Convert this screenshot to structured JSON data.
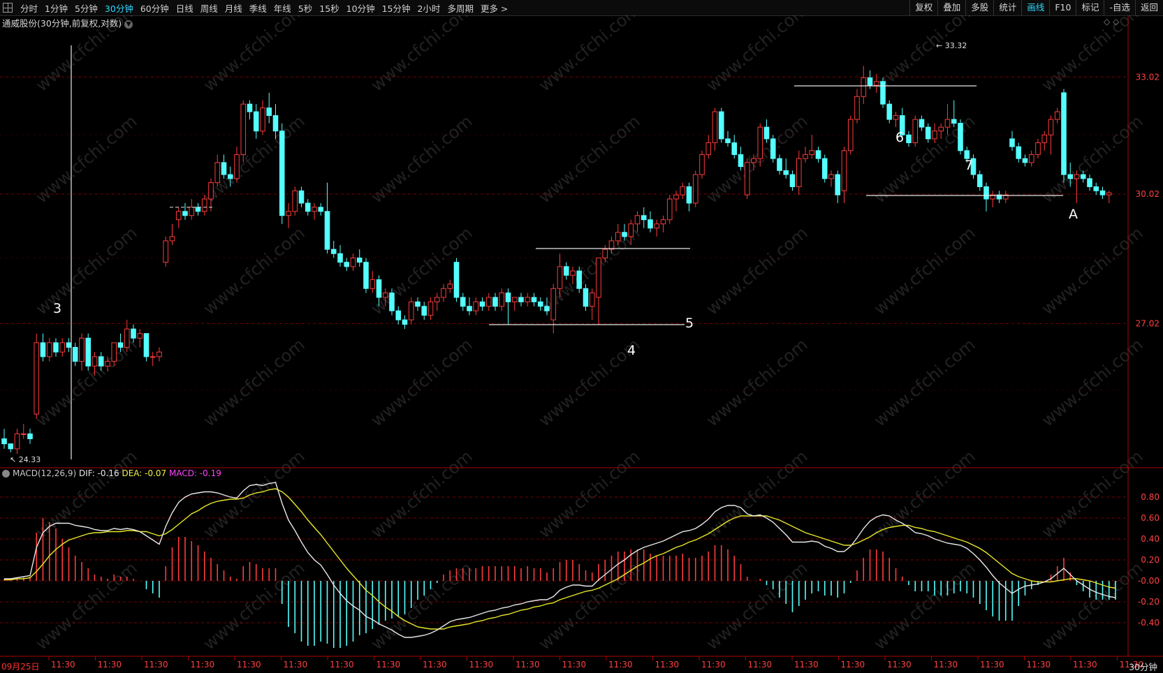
{
  "toolbar": {
    "periods": [
      {
        "label": "分时"
      },
      {
        "label": "1分钟"
      },
      {
        "label": "5分钟"
      },
      {
        "label": "30分钟",
        "active": true
      },
      {
        "label": "60分钟"
      },
      {
        "label": "日线"
      },
      {
        "label": "周线"
      },
      {
        "label": "月线"
      },
      {
        "label": "季线"
      },
      {
        "label": "年线"
      },
      {
        "label": "5秒"
      },
      {
        "label": "15秒"
      },
      {
        "label": "10分钟"
      },
      {
        "label": "15分钟"
      },
      {
        "label": "2小时"
      },
      {
        "label": "多周期"
      },
      {
        "label": "更多 >"
      }
    ],
    "right_buttons": [
      {
        "label": "复权"
      },
      {
        "label": "叠加"
      },
      {
        "label": "多股"
      },
      {
        "label": "统计"
      },
      {
        "label": "画线",
        "active": true
      },
      {
        "label": "F10"
      },
      {
        "label": "标记"
      },
      {
        "label": "-自选"
      },
      {
        "label": "返回"
      }
    ]
  },
  "chart_title": "通威股份(30分钟,前复权,对数)",
  "price_axis": [
    "33.02",
    "30.02",
    "27.02"
  ],
  "high_label": "33.32",
  "low_label": "24.33",
  "annotations": {
    "n3": "3",
    "n4": "4",
    "n5": "5",
    "n6": "6",
    "n7": "7",
    "nA": "A"
  },
  "macd": {
    "name": "MACD(12,26,9)",
    "dif_label": "DIF: -0.16",
    "dea_label": "DEA: -0.07",
    "macd_label": "MACD: -0.19",
    "axis": [
      "0.80",
      "0.60",
      "0.40",
      "0.20",
      "-0.00",
      "-0.20",
      "-0.40"
    ]
  },
  "time_axis": {
    "first_date": "09月25日",
    "tick_label": "11:30",
    "period": "30分钟"
  },
  "watermark": "www.cfchi.com",
  "colors": {
    "up": "#ff3b3b",
    "down": "#54ffff",
    "dif": "#e8e8e8",
    "dea": "#e8e82a",
    "grid": "#7a0000",
    "active": "#2fd9ff"
  },
  "chart_data": {
    "type": "candlestick",
    "scale": "log",
    "interval": "30分钟",
    "price_range": [
      24.33,
      33.32
    ],
    "candles": [
      [
        24.6,
        24.8,
        24.4,
        24.5
      ],
      [
        24.5,
        24.5,
        24.33,
        24.4
      ],
      [
        24.4,
        24.8,
        24.3,
        24.7
      ],
      [
        24.7,
        24.9,
        24.6,
        24.7
      ],
      [
        24.7,
        24.8,
        24.5,
        24.6
      ],
      [
        25.1,
        26.8,
        25.0,
        26.6
      ],
      [
        26.6,
        26.8,
        26.2,
        26.3
      ],
      [
        26.3,
        26.7,
        26.2,
        26.6
      ],
      [
        26.6,
        26.7,
        26.3,
        26.4
      ],
      [
        26.4,
        26.7,
        26.3,
        26.6
      ],
      [
        26.6,
        26.7,
        26.4,
        26.5
      ],
      [
        26.5,
        26.6,
        26.1,
        26.2
      ],
      [
        26.2,
        26.8,
        26.0,
        26.7
      ],
      [
        26.7,
        26.8,
        26.0,
        26.1
      ],
      [
        26.1,
        26.4,
        25.9,
        26.3
      ],
      [
        26.3,
        26.4,
        26.0,
        26.1
      ],
      [
        26.1,
        26.3,
        26.0,
        26.2
      ],
      [
        26.2,
        26.6,
        26.1,
        26.6
      ],
      [
        26.6,
        26.8,
        26.4,
        26.5
      ],
      [
        26.5,
        27.1,
        26.4,
        26.9
      ],
      [
        26.9,
        27.0,
        26.6,
        26.7
      ],
      [
        26.7,
        26.9,
        26.5,
        26.8
      ],
      [
        26.8,
        26.8,
        26.2,
        26.3
      ],
      [
        26.3,
        26.4,
        26.1,
        26.3
      ],
      [
        26.3,
        26.5,
        26.2,
        26.4
      ],
      [
        28.4,
        29.0,
        28.3,
        28.9
      ],
      [
        28.9,
        29.3,
        28.8,
        29.0
      ],
      [
        29.4,
        29.7,
        29.2,
        29.6
      ],
      [
        29.6,
        29.8,
        29.4,
        29.5
      ],
      [
        29.5,
        29.9,
        29.4,
        29.7
      ],
      [
        29.7,
        29.8,
        29.5,
        29.6
      ],
      [
        29.6,
        30.0,
        29.5,
        29.9
      ],
      [
        29.9,
        30.4,
        29.6,
        30.3
      ],
      [
        30.3,
        31.0,
        30.2,
        30.8
      ],
      [
        30.8,
        31.0,
        30.4,
        30.5
      ],
      [
        30.5,
        30.7,
        30.2,
        30.4
      ],
      [
        30.4,
        31.2,
        30.3,
        31.0
      ],
      [
        31.0,
        32.4,
        30.8,
        32.3
      ],
      [
        32.3,
        32.4,
        31.9,
        32.1
      ],
      [
        32.1,
        32.3,
        31.4,
        31.6
      ],
      [
        31.6,
        32.4,
        31.5,
        32.2
      ],
      [
        32.2,
        32.6,
        31.8,
        32.0
      ],
      [
        32.0,
        32.3,
        31.4,
        31.6
      ],
      [
        31.6,
        31.8,
        29.3,
        29.5
      ],
      [
        29.5,
        29.8,
        29.2,
        29.6
      ],
      [
        29.6,
        30.2,
        29.5,
        30.1
      ],
      [
        30.1,
        30.2,
        29.7,
        29.8
      ],
      [
        29.8,
        29.9,
        29.5,
        29.6
      ],
      [
        29.6,
        29.8,
        29.4,
        29.7
      ],
      [
        29.7,
        29.8,
        29.5,
        29.6
      ],
      [
        29.6,
        30.3,
        28.6,
        28.7
      ],
      [
        28.7,
        28.9,
        28.5,
        28.6
      ],
      [
        28.6,
        28.8,
        28.3,
        28.4
      ],
      [
        28.4,
        28.5,
        28.2,
        28.3
      ],
      [
        28.3,
        28.6,
        28.2,
        28.5
      ],
      [
        28.5,
        28.7,
        28.3,
        28.4
      ],
      [
        28.4,
        28.5,
        27.7,
        27.8
      ],
      [
        27.8,
        28.2,
        27.7,
        28.0
      ],
      [
        28.0,
        28.1,
        27.4,
        27.6
      ],
      [
        27.6,
        27.8,
        27.4,
        27.7
      ],
      [
        27.7,
        27.8,
        27.2,
        27.3
      ],
      [
        27.3,
        27.4,
        27.0,
        27.1
      ],
      [
        27.1,
        27.2,
        26.9,
        27.0
      ],
      [
        27.1,
        27.6,
        27.0,
        27.5
      ],
      [
        27.5,
        27.6,
        27.3,
        27.4
      ],
      [
        27.4,
        27.5,
        27.1,
        27.2
      ],
      [
        27.2,
        27.6,
        27.1,
        27.5
      ],
      [
        27.5,
        27.7,
        27.3,
        27.6
      ],
      [
        27.6,
        27.9,
        27.5,
        27.8
      ],
      [
        27.8,
        28.0,
        27.7,
        27.9
      ],
      [
        28.4,
        28.5,
        27.5,
        27.6
      ],
      [
        27.6,
        27.7,
        27.3,
        27.4
      ],
      [
        27.4,
        27.6,
        27.2,
        27.3
      ],
      [
        27.3,
        27.6,
        27.2,
        27.5
      ],
      [
        27.5,
        27.6,
        27.3,
        27.4
      ],
      [
        27.4,
        27.7,
        27.3,
        27.6
      ],
      [
        27.6,
        27.7,
        27.3,
        27.4
      ],
      [
        27.4,
        27.8,
        27.3,
        27.7
      ],
      [
        27.7,
        27.8,
        27.0,
        27.5
      ],
      [
        27.5,
        27.6,
        27.3,
        27.6
      ],
      [
        27.6,
        27.7,
        27.4,
        27.5
      ],
      [
        27.5,
        27.7,
        27.4,
        27.6
      ],
      [
        27.6,
        27.7,
        27.4,
        27.5
      ],
      [
        27.5,
        27.6,
        27.3,
        27.4
      ],
      [
        27.4,
        27.6,
        27.2,
        27.3
      ],
      [
        27.1,
        27.9,
        26.8,
        27.8
      ],
      [
        27.8,
        28.6,
        27.6,
        28.3
      ],
      [
        28.3,
        28.4,
        28.0,
        28.1
      ],
      [
        28.1,
        28.3,
        27.9,
        28.2
      ],
      [
        28.2,
        28.3,
        27.7,
        27.8
      ],
      [
        27.8,
        27.9,
        27.3,
        27.4
      ],
      [
        27.4,
        27.8,
        27.1,
        27.7
      ],
      [
        27.6,
        28.5,
        27.0,
        28.5
      ],
      [
        28.5,
        28.8,
        28.4,
        28.7
      ],
      [
        28.7,
        29.0,
        28.6,
        28.9
      ],
      [
        28.9,
        29.3,
        28.8,
        29.1
      ],
      [
        29.1,
        29.3,
        28.9,
        29.0
      ],
      [
        29.0,
        29.4,
        28.8,
        29.3
      ],
      [
        29.3,
        29.6,
        29.1,
        29.5
      ],
      [
        29.5,
        29.7,
        29.2,
        29.4
      ],
      [
        29.4,
        29.6,
        29.1,
        29.2
      ],
      [
        29.2,
        29.4,
        29.0,
        29.3
      ],
      [
        29.3,
        29.5,
        29.1,
        29.4
      ],
      [
        29.4,
        30.0,
        29.3,
        29.9
      ],
      [
        29.9,
        30.1,
        29.6,
        30.0
      ],
      [
        30.0,
        30.3,
        29.9,
        30.2
      ],
      [
        30.2,
        30.3,
        29.6,
        29.8
      ],
      [
        29.8,
        30.6,
        29.7,
        30.5
      ],
      [
        30.5,
        31.1,
        30.4,
        31.0
      ],
      [
        31.0,
        31.5,
        30.9,
        31.3
      ],
      [
        31.3,
        32.2,
        31.1,
        32.1
      ],
      [
        32.1,
        32.2,
        31.3,
        31.4
      ],
      [
        31.4,
        31.6,
        31.2,
        31.3
      ],
      [
        31.3,
        31.5,
        30.9,
        31.0
      ],
      [
        31.0,
        31.2,
        30.6,
        30.7
      ],
      [
        30.0,
        30.9,
        29.9,
        30.8
      ],
      [
        30.8,
        31.0,
        30.6,
        30.9
      ],
      [
        30.9,
        31.8,
        30.7,
        31.7
      ],
      [
        31.7,
        31.9,
        31.3,
        31.4
      ],
      [
        31.4,
        31.5,
        30.8,
        30.9
      ],
      [
        30.9,
        31.0,
        30.5,
        30.6
      ],
      [
        30.6,
        30.9,
        30.4,
        30.5
      ],
      [
        30.5,
        30.6,
        30.1,
        30.2
      ],
      [
        30.2,
        31.1,
        30.0,
        30.9
      ],
      [
        30.9,
        31.2,
        30.8,
        31.0
      ],
      [
        31.0,
        31.5,
        30.9,
        31.1
      ],
      [
        31.1,
        31.2,
        30.8,
        30.9
      ],
      [
        30.9,
        31.0,
        30.3,
        30.4
      ],
      [
        30.4,
        30.6,
        30.2,
        30.5
      ],
      [
        30.5,
        30.6,
        29.8,
        30.0
      ],
      [
        30.1,
        31.2,
        29.8,
        31.1
      ],
      [
        31.1,
        32.0,
        31.0,
        31.9
      ],
      [
        31.9,
        32.7,
        31.8,
        32.5
      ],
      [
        32.5,
        33.32,
        32.3,
        33.0
      ],
      [
        33.0,
        33.2,
        32.7,
        32.8
      ],
      [
        32.8,
        33.1,
        32.6,
        32.9
      ],
      [
        32.9,
        33.0,
        32.2,
        32.3
      ],
      [
        32.3,
        32.4,
        31.8,
        31.9
      ],
      [
        31.9,
        32.1,
        31.7,
        32.0
      ],
      [
        32.0,
        32.2,
        31.4,
        31.5
      ],
      [
        31.5,
        31.6,
        31.2,
        31.3
      ],
      [
        31.3,
        32.0,
        31.2,
        31.9
      ],
      [
        31.9,
        32.0,
        31.6,
        31.7
      ],
      [
        31.7,
        31.8,
        31.3,
        31.4
      ],
      [
        31.4,
        31.8,
        31.3,
        31.6
      ],
      [
        31.6,
        31.8,
        31.4,
        31.7
      ],
      [
        31.7,
        32.3,
        31.5,
        31.9
      ],
      [
        31.9,
        32.4,
        31.7,
        31.8
      ],
      [
        31.8,
        31.9,
        31.0,
        31.1
      ],
      [
        31.1,
        31.2,
        30.8,
        30.9
      ],
      [
        30.9,
        31.0,
        30.4,
        30.5
      ],
      [
        30.5,
        30.6,
        30.1,
        30.2
      ],
      [
        30.2,
        30.3,
        29.6,
        29.9
      ],
      [
        29.9,
        30.1,
        29.7,
        30.0
      ],
      [
        30.0,
        30.1,
        29.8,
        29.9
      ],
      [
        29.9,
        30.1,
        29.8,
        30.0
      ],
      [
        31.4,
        31.6,
        31.1,
        31.2
      ],
      [
        31.2,
        31.3,
        30.8,
        30.9
      ],
      [
        30.9,
        31.0,
        30.7,
        30.8
      ],
      [
        30.8,
        31.1,
        30.7,
        31.0
      ],
      [
        31.0,
        31.4,
        30.9,
        31.3
      ],
      [
        31.3,
        31.6,
        31.1,
        31.5
      ],
      [
        31.5,
        32.0,
        31.0,
        31.9
      ],
      [
        31.9,
        32.2,
        31.8,
        32.1
      ],
      [
        32.6,
        32.7,
        30.3,
        30.5
      ],
      [
        30.5,
        30.8,
        30.2,
        30.4
      ],
      [
        30.4,
        30.6,
        29.8,
        30.5
      ],
      [
        30.5,
        30.6,
        30.3,
        30.4
      ],
      [
        30.4,
        30.5,
        30.1,
        30.2
      ],
      [
        30.2,
        30.3,
        30.0,
        30.1
      ],
      [
        30.1,
        30.2,
        29.9,
        30.0
      ],
      [
        30.0,
        30.1,
        29.8,
        30.05
      ]
    ],
    "macd": {
      "dif_last": -0.16,
      "dea_last": -0.07,
      "macd_last": -0.19,
      "dif": [
        0.02,
        0.02,
        0.03,
        0.04,
        0.05,
        0.32,
        0.46,
        0.52,
        0.55,
        0.55,
        0.55,
        0.53,
        0.52,
        0.51,
        0.49,
        0.48,
        0.48,
        0.5,
        0.49,
        0.5,
        0.49,
        0.47,
        0.43,
        0.39,
        0.35,
        0.52,
        0.65,
        0.75,
        0.8,
        0.83,
        0.84,
        0.85,
        0.85,
        0.84,
        0.82,
        0.8,
        0.79,
        0.86,
        0.91,
        0.92,
        0.91,
        0.93,
        0.94,
        0.74,
        0.58,
        0.48,
        0.37,
        0.27,
        0.2,
        0.15,
        0.06,
        -0.04,
        -0.12,
        -0.19,
        -0.24,
        -0.28,
        -0.34,
        -0.37,
        -0.41,
        -0.44,
        -0.47,
        -0.51,
        -0.54,
        -0.54,
        -0.53,
        -0.52,
        -0.5,
        -0.47,
        -0.43,
        -0.39,
        -0.37,
        -0.36,
        -0.35,
        -0.33,
        -0.31,
        -0.29,
        -0.28,
        -0.26,
        -0.25,
        -0.23,
        -0.22,
        -0.2,
        -0.19,
        -0.18,
        -0.18,
        -0.15,
        -0.09,
        -0.06,
        -0.04,
        -0.04,
        -0.05,
        -0.05,
        0.01,
        0.06,
        0.11,
        0.16,
        0.2,
        0.25,
        0.29,
        0.32,
        0.34,
        0.36,
        0.38,
        0.41,
        0.44,
        0.47,
        0.48,
        0.5,
        0.54,
        0.59,
        0.66,
        0.7,
        0.72,
        0.72,
        0.7,
        0.64,
        0.62,
        0.63,
        0.6,
        0.56,
        0.5,
        0.44,
        0.37,
        0.37,
        0.37,
        0.38,
        0.37,
        0.33,
        0.31,
        0.28,
        0.28,
        0.33,
        0.41,
        0.5,
        0.57,
        0.61,
        0.63,
        0.62,
        0.58,
        0.55,
        0.51,
        0.46,
        0.45,
        0.43,
        0.4,
        0.38,
        0.36,
        0.35,
        0.34,
        0.31,
        0.26,
        0.2,
        0.13,
        0.05,
        -0.02,
        -0.07,
        -0.12,
        -0.08,
        -0.05,
        -0.04,
        -0.03,
        -0.01,
        0.02,
        0.07,
        0.12,
        0.06,
        0.0,
        -0.04,
        -0.08,
        -0.11,
        -0.13,
        -0.15,
        -0.16
      ],
      "dea": [
        0.01,
        0.01,
        0.02,
        0.02,
        0.03,
        0.09,
        0.16,
        0.24,
        0.3,
        0.35,
        0.39,
        0.41,
        0.43,
        0.45,
        0.46,
        0.46,
        0.47,
        0.47,
        0.47,
        0.48,
        0.48,
        0.47,
        0.47,
        0.45,
        0.43,
        0.45,
        0.49,
        0.54,
        0.59,
        0.64,
        0.67,
        0.71,
        0.74,
        0.76,
        0.77,
        0.78,
        0.78,
        0.79,
        0.82,
        0.84,
        0.85,
        0.87,
        0.88,
        0.85,
        0.8,
        0.73,
        0.66,
        0.58,
        0.51,
        0.44,
        0.36,
        0.28,
        0.2,
        0.12,
        0.05,
        -0.02,
        -0.09,
        -0.14,
        -0.2,
        -0.25,
        -0.29,
        -0.34,
        -0.38,
        -0.41,
        -0.44,
        -0.45,
        -0.46,
        -0.46,
        -0.46,
        -0.44,
        -0.43,
        -0.42,
        -0.41,
        -0.39,
        -0.38,
        -0.36,
        -0.35,
        -0.33,
        -0.32,
        -0.3,
        -0.28,
        -0.27,
        -0.25,
        -0.24,
        -0.22,
        -0.21,
        -0.18,
        -0.16,
        -0.14,
        -0.12,
        -0.1,
        -0.09,
        -0.07,
        -0.04,
        -0.01,
        0.02,
        0.06,
        0.1,
        0.14,
        0.17,
        0.21,
        0.24,
        0.26,
        0.29,
        0.32,
        0.34,
        0.37,
        0.39,
        0.42,
        0.45,
        0.49,
        0.53,
        0.57,
        0.6,
        0.62,
        0.62,
        0.62,
        0.62,
        0.62,
        0.6,
        0.58,
        0.55,
        0.52,
        0.49,
        0.46,
        0.44,
        0.42,
        0.4,
        0.38,
        0.36,
        0.34,
        0.34,
        0.36,
        0.39,
        0.42,
        0.46,
        0.49,
        0.51,
        0.52,
        0.53,
        0.53,
        0.51,
        0.5,
        0.48,
        0.47,
        0.45,
        0.43,
        0.41,
        0.39,
        0.37,
        0.34,
        0.31,
        0.27,
        0.22,
        0.17,
        0.12,
        0.07,
        0.04,
        0.02,
        0.0,
        -0.01,
        -0.01,
        -0.01,
        0.0,
        0.01,
        0.02,
        0.02,
        0.01,
        0.0,
        -0.02,
        -0.04,
        -0.06,
        -0.07
      ]
    }
  }
}
